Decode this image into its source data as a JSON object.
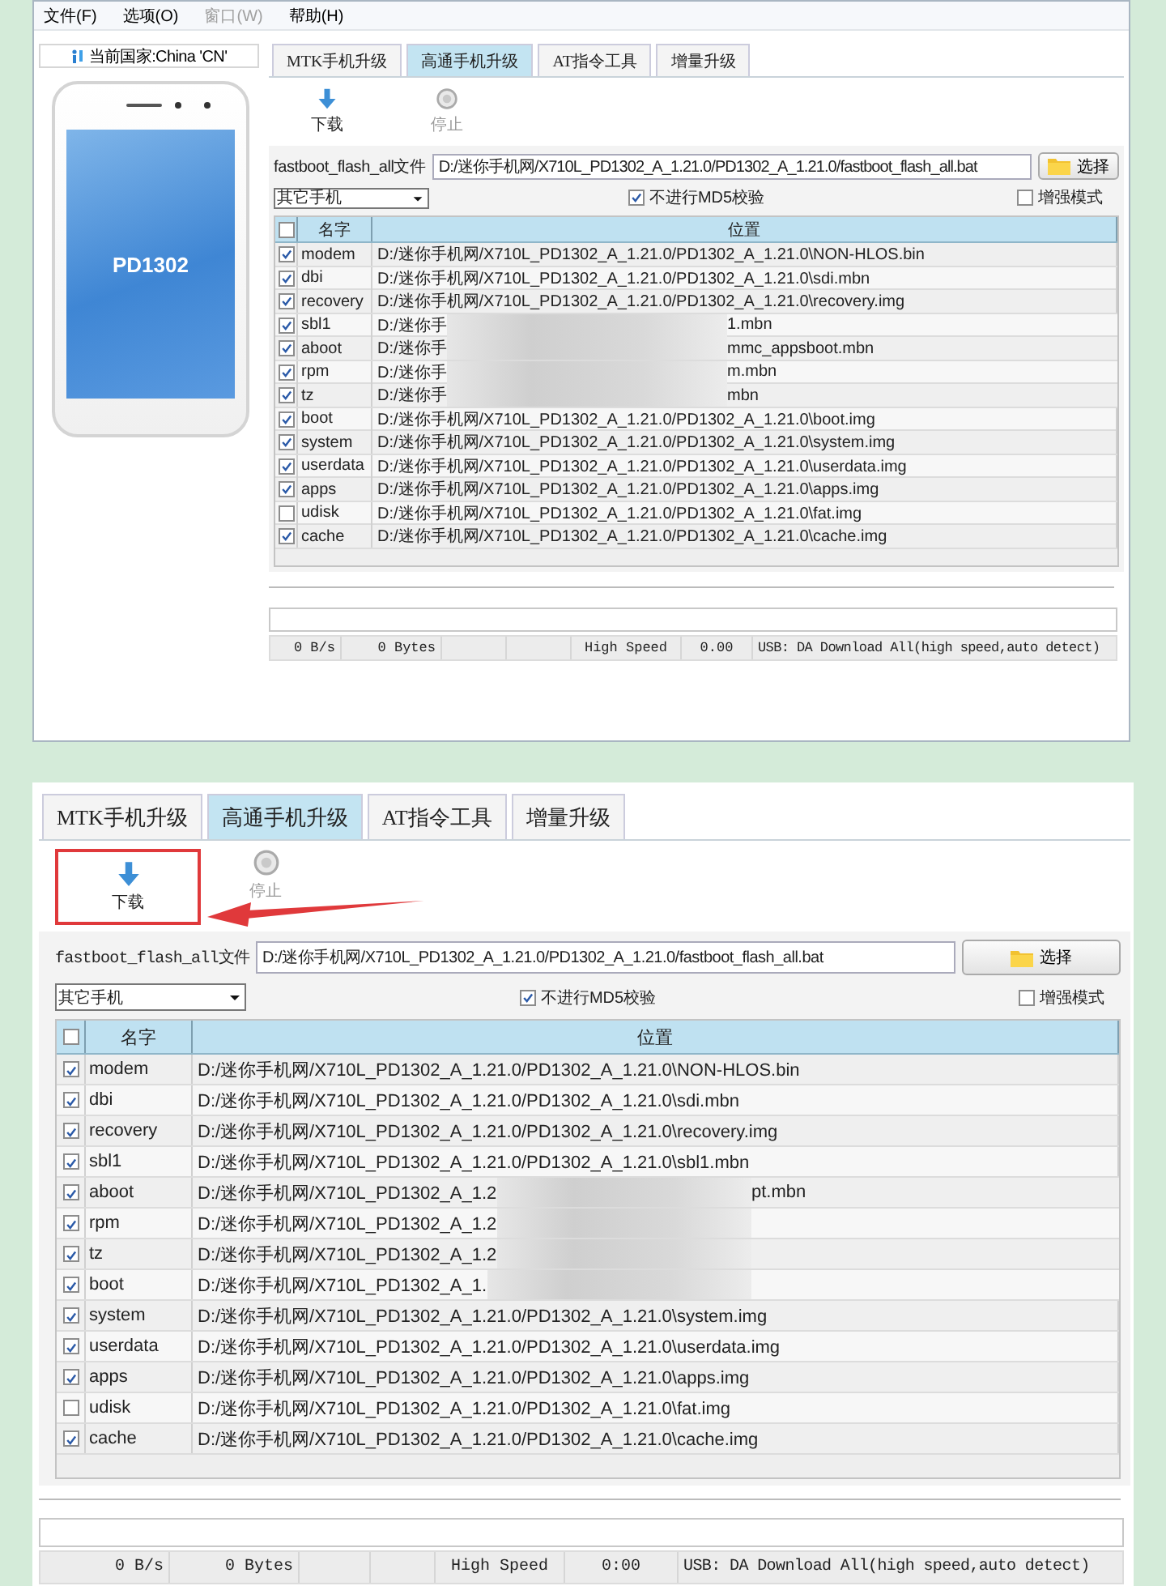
{
  "top_window": {
    "menu": [
      {
        "label": "文件(F)",
        "disabled": false
      },
      {
        "label": "选项(O)",
        "disabled": false
      },
      {
        "label": "窗口(W)",
        "disabled": true
      },
      {
        "label": "帮助(H)",
        "disabled": false
      }
    ],
    "country_label": "当前国家:China 'CN'",
    "phone_model": "PD1302",
    "tool": {
      "tabs": [
        {
          "label": "MTK手机升级",
          "selected": false
        },
        {
          "label": "高通手机升级",
          "selected": true
        },
        {
          "label": "AT指令工具",
          "selected": false
        },
        {
          "label": "增量升级",
          "selected": false
        }
      ],
      "toolbar": [
        {
          "kind": "download",
          "label": "下载",
          "disabled": false
        },
        {
          "kind": "stop",
          "label": "停止",
          "disabled": true
        }
      ],
      "file_label": "fastboot_flash_all文件",
      "file_path": "D:/迷你手机网/X710L_PD1302_A_1.21.0/PD1302_A_1.21.0/fastboot_flash_all.bat",
      "choose_button": "选择",
      "phone_type": "其它手机",
      "md5_check": {
        "label": "不进行MD5校验",
        "checked": true
      },
      "enhanced_mode": {
        "label": "增强模式",
        "checked": false
      },
      "header_checked": false,
      "columns": [
        "名字",
        "位置"
      ],
      "rows": [
        {
          "name": "modem",
          "checked": true,
          "blurred": false,
          "location": "D:/迷你手机网/X710L_PD1302_A_1.21.0/PD1302_A_1.21.0\\NON-HLOS.bin"
        },
        {
          "name": "dbi",
          "checked": true,
          "blurred": false,
          "location": "D:/迷你手机网/X710L_PD1302_A_1.21.0/PD1302_A_1.21.0\\sdi.mbn"
        },
        {
          "name": "recovery",
          "checked": true,
          "blurred": false,
          "location": "D:/迷你手机网/X710L_PD1302_A_1.21.0/PD1302_A_1.21.0\\recovery.img"
        },
        {
          "name": "sbl1",
          "checked": true,
          "blurred": true,
          "location": "D:/迷你手",
          "location_end": "1.mbn"
        },
        {
          "name": "aboot",
          "checked": true,
          "blurred": true,
          "location": "D:/迷你手",
          "location_end": "mmc_appsboot.mbn"
        },
        {
          "name": "rpm",
          "checked": true,
          "blurred": true,
          "location": "D:/迷你手",
          "location_end": "m.mbn"
        },
        {
          "name": "tz",
          "checked": true,
          "blurred": true,
          "location": "D:/迷你手",
          "location_end": "mbn"
        },
        {
          "name": "boot",
          "checked": true,
          "blurred": false,
          "location": "D:/迷你手机网/X710L_PD1302_A_1.21.0/PD1302_A_1.21.0\\boot.img"
        },
        {
          "name": "system",
          "checked": true,
          "blurred": false,
          "location": "D:/迷你手机网/X710L_PD1302_A_1.21.0/PD1302_A_1.21.0\\system.img"
        },
        {
          "name": "userdata",
          "checked": true,
          "blurred": false,
          "location": "D:/迷你手机网/X710L_PD1302_A_1.21.0/PD1302_A_1.21.0\\userdata.img"
        },
        {
          "name": "apps",
          "checked": true,
          "blurred": false,
          "location": "D:/迷你手机网/X710L_PD1302_A_1.21.0/PD1302_A_1.21.0\\apps.img"
        },
        {
          "name": "udisk",
          "checked": false,
          "blurred": false,
          "location": "D:/迷你手机网/X710L_PD1302_A_1.21.0/PD1302_A_1.21.0\\fat.img"
        },
        {
          "name": "cache",
          "checked": true,
          "blurred": false,
          "location": "D:/迷你手机网/X710L_PD1302_A_1.21.0/PD1302_A_1.21.0\\cache.img"
        }
      ],
      "status_bar": [
        "0 B/s",
        "0 Bytes",
        "High Speed",
        "0.00",
        "USB: DA Download All(high speed,auto detect)"
      ]
    }
  },
  "bottom_window": {
    "tool": {
      "tabs": [
        {
          "label": "MTK手机升级",
          "selected": false
        },
        {
          "label": "高通手机升级",
          "selected": true
        },
        {
          "label": "AT指令工具",
          "selected": false
        },
        {
          "label": "增量升级",
          "selected": false
        }
      ],
      "toolbar": [
        {
          "kind": "download",
          "label": "下载",
          "disabled": false
        },
        {
          "kind": "stop",
          "label": "停止",
          "disabled": true
        }
      ],
      "file_label": "fastboot_flash_all文件",
      "file_path": "D:/迷你手机网/X710L_PD1302_A_1.21.0/PD1302_A_1.21.0/fastboot_flash_all.bat",
      "choose_button": "选择",
      "phone_type": "其它手机",
      "md5_check": {
        "label": "不进行MD5校验",
        "checked": true
      },
      "enhanced_mode": {
        "label": "增强模式",
        "checked": false
      },
      "header_checked": false,
      "columns": [
        "名字",
        "位置"
      ],
      "rows": [
        {
          "name": "modem",
          "checked": true,
          "blurred": false,
          "location": "D:/迷你手机网/X710L_PD1302_A_1.21.0/PD1302_A_1.21.0\\NON-HLOS.bin"
        },
        {
          "name": "dbi",
          "checked": true,
          "blurred": false,
          "location": "D:/迷你手机网/X710L_PD1302_A_1.21.0/PD1302_A_1.21.0\\sdi.mbn"
        },
        {
          "name": "recovery",
          "checked": true,
          "blurred": false,
          "location": "D:/迷你手机网/X710L_PD1302_A_1.21.0/PD1302_A_1.21.0\\recovery.img"
        },
        {
          "name": "sbl1",
          "checked": true,
          "blurred": false,
          "location": "D:/迷你手机网/X710L_PD1302_A_1.21.0/PD1302_A_1.21.0\\sbl1.mbn"
        },
        {
          "name": "aboot",
          "checked": true,
          "blurred": true,
          "location": "D:/迷你手机网/X710L_PD1302_A_1.2",
          "location_end": "pt.mbn"
        },
        {
          "name": "rpm",
          "checked": true,
          "blurred": true,
          "location": "D:/迷你手机网/X710L_PD1302_A_1.2"
        },
        {
          "name": "tz",
          "checked": true,
          "blurred": true,
          "location": "D:/迷你手机网/X710L_PD1302_A_1.2"
        },
        {
          "name": "boot",
          "checked": true,
          "blurred": true,
          "location": "D:/迷你手机网/X710L_PD1302_A_1."
        },
        {
          "name": "system",
          "checked": true,
          "blurred": false,
          "location": "D:/迷你手机网/X710L_PD1302_A_1.21.0/PD1302_A_1.21.0\\system.img"
        },
        {
          "name": "userdata",
          "checked": true,
          "blurred": false,
          "location": "D:/迷你手机网/X710L_PD1302_A_1.21.0/PD1302_A_1.21.0\\userdata.img"
        },
        {
          "name": "apps",
          "checked": true,
          "blurred": false,
          "location": "D:/迷你手机网/X710L_PD1302_A_1.21.0/PD1302_A_1.21.0\\apps.img"
        },
        {
          "name": "udisk",
          "checked": false,
          "blurred": false,
          "location": "D:/迷你手机网/X710L_PD1302_A_1.21.0/PD1302_A_1.21.0\\fat.img"
        },
        {
          "name": "cache",
          "checked": true,
          "blurred": false,
          "location": "D:/迷你手机网/X710L_PD1302_A_1.21.0/PD1302_A_1.21.0\\cache.img"
        }
      ],
      "status_bar": [
        "0 B/s",
        "0 Bytes",
        "High Speed",
        "0:00",
        "USB: DA Download All(high speed,auto detect)"
      ]
    }
  }
}
